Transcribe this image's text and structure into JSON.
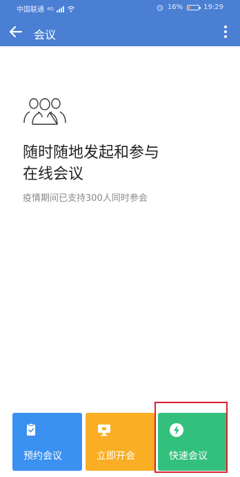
{
  "statusbar": {
    "carrier": "中国联通",
    "network": "4G",
    "battery": "16%",
    "time": "19:29",
    "battery_level": 0.16
  },
  "header": {
    "title": "会议",
    "back_icon": "back-arrow-icon",
    "menu_icon": "more-vert-icon",
    "bg_color": "#4a7fd3"
  },
  "main": {
    "icon": "people-group-icon",
    "headline_line1": "随时随地发起和参与",
    "headline_line2": "在线会议",
    "subtitle": "疫情期间已支持300人同时参会"
  },
  "actions": [
    {
      "label": "预约会议",
      "icon": "calendar-clipboard-icon",
      "color": "#3a91f0"
    },
    {
      "label": "立即开会",
      "icon": "monitor-icon",
      "color": "#f9ae23"
    },
    {
      "label": "快速会议",
      "icon": "lightning-icon",
      "color": "#33c07d"
    }
  ],
  "highlight_color": "#d91f2c"
}
